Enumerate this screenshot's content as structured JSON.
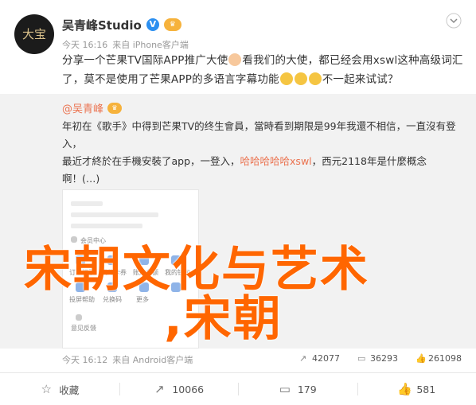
{
  "author": {
    "name": "吴青峰Studio",
    "vip_label": "V",
    "avatar_text": "大宝"
  },
  "meta": {
    "time": "今天 16:16",
    "from": "来自 iPhone客户端"
  },
  "post": {
    "text_part1": "分享一个芒果TV国际APP推广大使",
    "text_part2": "看我们的大使，都已经会用xswl这种高级词汇了，莫不是使用了芒果APP的多语言字幕功能",
    "text_part3": "不一起来试试？"
  },
  "repost": {
    "author": "@吴青峰",
    "line1_pre": "年初在《歌手》中得到芒果TV的终生會員，當時看到期限是99年我還不相信，一直沒有登入，",
    "line2": "最近才終於在手機安裝了app，一登入，",
    "line2_kw": "哈哈哈哈哈xswl",
    "line2_post": "，西元2118年是什麼概念",
    "line3": "啊！(…)",
    "app_labels": {
      "membership": "会员中心",
      "a1": "订单记录",
      "a2": "我的卡券",
      "a3": "账户余额",
      "a4": "我的钱包",
      "b1": "投屏帮助",
      "b2": "兑换码",
      "b3": "更多",
      "b4": "",
      "c1": "意见反馈"
    },
    "time": "今天 16:12",
    "from": "来自 Android客户端",
    "reposts": "42077",
    "comments": "36293",
    "likes": "261098"
  },
  "overlay": {
    "line1": "宋朝文化与艺术",
    "line2": ",宋朝"
  },
  "footer": {
    "collect": "收藏",
    "repost": "10066",
    "comment": "179",
    "like": "581"
  },
  "colors": {
    "overlay": "#ff6600",
    "link": "#eb7350",
    "verified": "#2c8ff0"
  }
}
